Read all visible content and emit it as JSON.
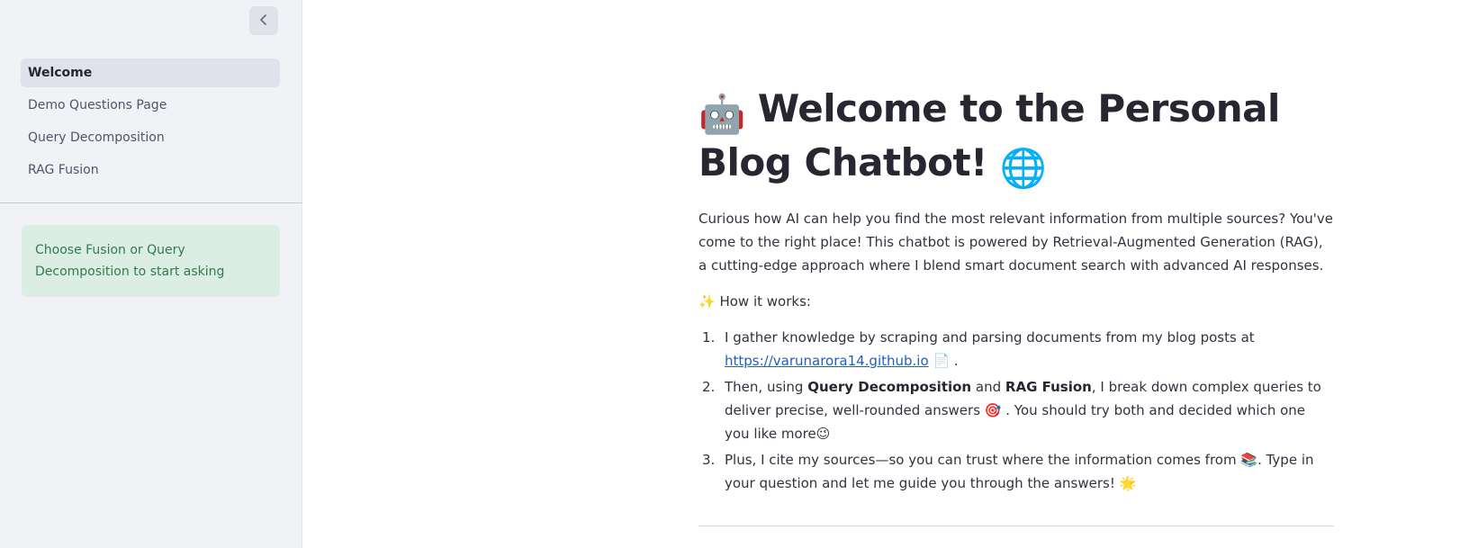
{
  "sidebar": {
    "collapse_icon": "chevron-left-icon",
    "nav_items": [
      {
        "label": "Welcome",
        "active": true
      },
      {
        "label": "Demo Questions Page",
        "active": false
      },
      {
        "label": "Query Decomposition",
        "active": false
      },
      {
        "label": "RAG Fusion",
        "active": false
      }
    ],
    "info_message": "Choose Fusion or Query Decomposition to start asking"
  },
  "main": {
    "title_emoji_start": "🤖",
    "title_text": "Welcome to the Personal Blog Chatbot!",
    "title_emoji_end": "🌐",
    "intro": "Curious how AI can help you find the most relevant information from multiple sources? You've come to the right place! This chatbot is powered by Retrieval-Augmented Generation (RAG), a cutting-edge approach where I blend smart document search with advanced AI responses.",
    "how_emoji": "✨",
    "how_label": "How it works:",
    "steps": [
      {
        "num": "1.",
        "text_a": "I gather knowledge by scraping and parsing documents from my blog posts at",
        "link": "https://varunarora14.github.io",
        "emoji": "📄",
        "text_b": "."
      },
      {
        "num": "2.",
        "text_a": "Then, using",
        "bold_a": "Query Decomposition",
        "text_b": "and",
        "bold_b": "RAG Fusion",
        "text_c": ", I break down complex queries to deliver precise, well-rounded answers",
        "emoji_a": "🎯",
        "text_d": ". You should try both and decided which one you like more",
        "emoji_b": "😉"
      },
      {
        "num": "3.",
        "text_a": "Plus, I cite my sources—so you can trust where the information comes from",
        "emoji_a": "📚",
        "text_b": ". Type in your question and let me guide you through the answers!",
        "emoji_b": "🌟"
      }
    ]
  },
  "colors": {
    "sidebar_bg": "#f0f2f6",
    "info_bg": "#dcede3",
    "info_text": "#2e7d4f",
    "link": "#1f5fbf"
  }
}
